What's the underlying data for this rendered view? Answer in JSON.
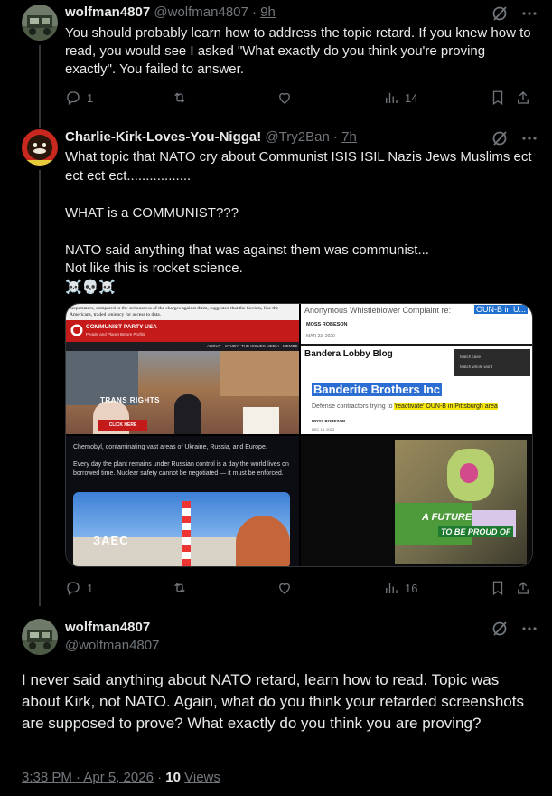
{
  "tweet1": {
    "name": "wolfman4807",
    "handle": "@wolfman4807",
    "sep": "·",
    "time": "9h",
    "text": "You should probably learn how to address the topic retard. If you knew how to read, you would see I asked \"What exactly do you think you're proving exactly\". You failed to answer.",
    "replies": "1",
    "views": "14"
  },
  "tweet2": {
    "name": "Charlie-Kirk-Loves-You-Nigga!",
    "handle": "@Try2Ban",
    "sep": "·",
    "time": "7h",
    "text": "What topic that NATO cry about Communist ISIS ISIL Nazis Jews Muslims ect ect ect ect.................\n\nWHAT is a COMMUNIST???\n\nNATO said anything that was against them was communist...\nNot like this is rocket science.\n☠️💀☠️",
    "replies": "1",
    "views": "16",
    "media": {
      "img1": {
        "caption": "perpetrators, compared to the seriousness of the charges against them, suggested that the Soviets, like the Americans, traded leniency for access to data.",
        "brand": "COMMUNIST PARTY USA",
        "tagline": "People and Planet Before Profits",
        "nav": [
          "ABOUT",
          "STUDY",
          "THE ISSUES",
          "MEDIA",
          "MEMBE"
        ],
        "sign1": "TRANS RIGHTS",
        "cta": "CLICK HERE"
      },
      "img2": {
        "title": "Anonymous Whistleblower Complaint re:",
        "highlight": "OUN-B in U...",
        "author": "MOSS ROBESON",
        "date": "MAR 23, 2020",
        "blog": "Bandera Lobby Blog",
        "menu1": "Match case",
        "menu2": "Match whole word",
        "headline": "Banderite Brothers Inc",
        "subtitle": "Defense contractors trying to",
        "subtitle_hl": "'reactivate' OUN-B in Pittsburgh area",
        "author2": "MOSS ROBESON",
        "date2": "DEC 14, 2023"
      },
      "img3": {
        "top": "Chernobyl, contaminating vast areas of Ukraine, Russia, and Europe.",
        "para": "Every day the plant remains under Russian control is a day the world lives on borrowed time. Nuclear safety cannot be negotiated — it must be enforced.",
        "sign": "ЗАЕС"
      },
      "img4": {
        "line1": "A FUTURE",
        "line2": "TO BE PROUD OF"
      }
    }
  },
  "tweet3": {
    "name": "wolfman4807",
    "handle": "@wolfman4807",
    "text": "I never said anything about NATO retard, learn how to read. Topic was about Kirk, not NATO. Again, what do you think your retarded screenshots are supposed to prove? What exactly do you think you are proving?",
    "time": "3:38 PM · Apr 5, 2026",
    "sep": "·",
    "views_count": "10",
    "views_label": "Views"
  },
  "colors": {
    "bg": "#000000",
    "text": "#e7e9ea",
    "muted": "#71767b",
    "border": "#2f3336"
  }
}
